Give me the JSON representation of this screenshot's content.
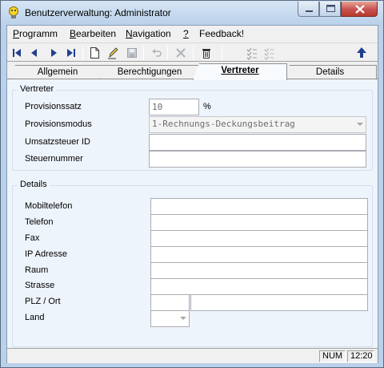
{
  "window": {
    "title": "Benutzerverwaltung: Administrator",
    "icon": "lightbulb-icon"
  },
  "menu": [
    {
      "accel": "P",
      "rest": "rogramm"
    },
    {
      "accel": "B",
      "rest": "earbeiten"
    },
    {
      "accel": "N",
      "rest": "avigation"
    },
    {
      "accel": "?",
      "rest": ""
    },
    {
      "accel": "",
      "rest": "Feedback!"
    }
  ],
  "toolbar": {
    "icons": [
      "first-record-icon",
      "previous-record-icon",
      "next-record-icon",
      "last-record-icon",
      "new-document-icon",
      "edit-pencil-icon",
      "save-disk-icon",
      "undo-icon",
      "cancel-x-icon",
      "delete-trash-icon",
      "checklist-icon",
      "checklist-dotted-icon",
      "up-arrow-icon"
    ]
  },
  "tabs": {
    "allgemein": "Allgemein",
    "berechtigungen": "Berechtigungen",
    "vertreter": "Vertreter",
    "details": "Details"
  },
  "vertreter_group": {
    "title": "Vertreter",
    "provisionssatz_label": "Provisionssatz",
    "provisionssatz_value": "10",
    "provisionssatz_unit": "%",
    "provisionsmodus_label": "Provisionsmodus",
    "provisionsmodus_value": "1-Rechnungs-Deckungsbeitrag",
    "ust_label": "Umsatzsteuer ID",
    "ust_value": "",
    "steuernummer_label": "Steuernummer",
    "steuernummer_value": ""
  },
  "details_group": {
    "title": "Details",
    "mobil_label": "Mobiltelefon",
    "telefon_label": "Telefon",
    "fax_label": "Fax",
    "ip_label": "IP Adresse",
    "raum_label": "Raum",
    "strasse_label": "Strasse",
    "plz_label": "PLZ / Ort",
    "land_label": "Land"
  },
  "statusbar": {
    "num": "NUM",
    "time": "12:20"
  },
  "colors": {
    "title_gradient_top": "#d7e5f5",
    "panel_bg": "#eef4fb",
    "close_button": "#c75050"
  }
}
